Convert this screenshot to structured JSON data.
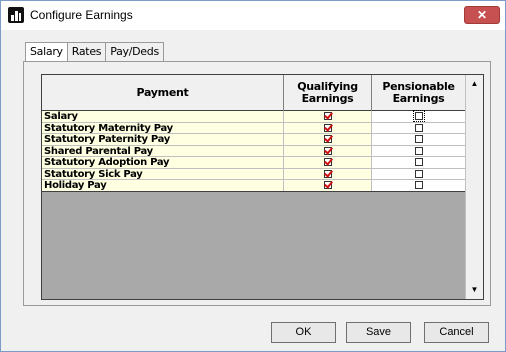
{
  "window": {
    "title": "Configure Earnings",
    "close_label": "✕"
  },
  "tabs": [
    {
      "label": "Salary"
    },
    {
      "label": "Rates"
    },
    {
      "label": "Pay/Deds"
    }
  ],
  "grid": {
    "headers": [
      "Payment",
      "Qualifying\nEarnings",
      "Pensionable\nEarnings"
    ],
    "rows": [
      {
        "payment": "Salary",
        "qualifying": true,
        "pensionable": false
      },
      {
        "payment": "Statutory Maternity Pay",
        "qualifying": true,
        "pensionable": false
      },
      {
        "payment": "Statutory Paternity Pay",
        "qualifying": true,
        "pensionable": false
      },
      {
        "payment": "Shared Parental Pay",
        "qualifying": true,
        "pensionable": false
      },
      {
        "payment": "Statutory Adoption Pay",
        "qualifying": true,
        "pensionable": false
      },
      {
        "payment": "Statutory Sick Pay",
        "qualifying": true,
        "pensionable": false
      },
      {
        "payment": "Holiday Pay",
        "qualifying": true,
        "pensionable": false
      }
    ]
  },
  "buttons": {
    "ok": "OK",
    "save": "Save",
    "cancel": "Cancel"
  },
  "colors": {
    "editable_cell": "#ffffe1",
    "check_mark": "#d01010",
    "grid_background": "#a9a9a9"
  }
}
